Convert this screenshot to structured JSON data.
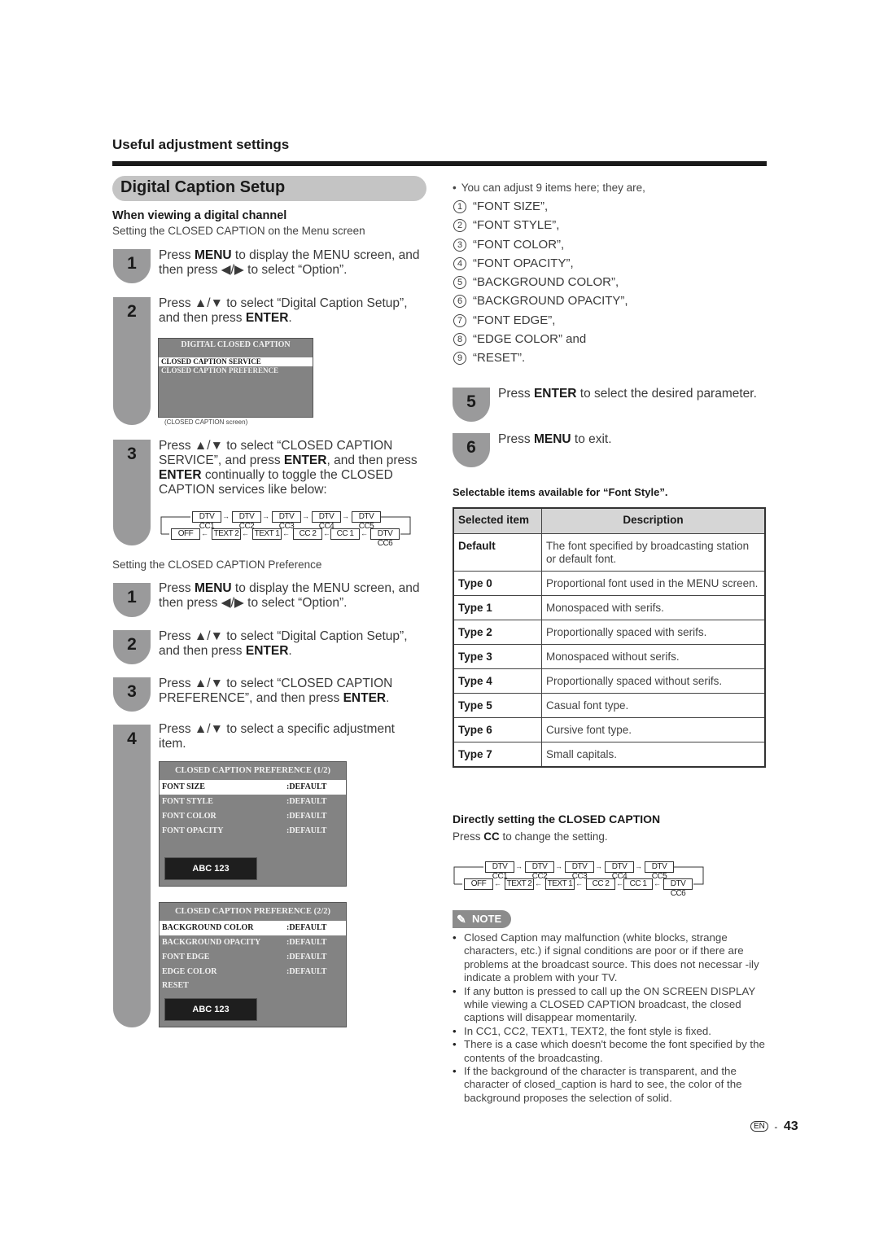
{
  "header": {
    "section_title": "Useful adjustment settings",
    "page_title": "Digital Caption Setup"
  },
  "left": {
    "subhead": "When viewing a digital channel",
    "subtext": "Setting the CLOSED CAPTION on the Menu screen",
    "service_steps": [
      {
        "num": "1",
        "pre": "Press ",
        "key": "MENU",
        "post": " to display the MENU screen, and then press ◀/▶ to select “Option”."
      },
      {
        "num": "2",
        "pre": "Press ▲/▼ to select “Digital Caption Setup”, and then press ",
        "key": "ENTER",
        "post": "."
      },
      {
        "num": "3",
        "pre": "Press ▲/▼ to select “CLOSED CAPTION SERVICE”, and press ",
        "key": "ENTER",
        "post": ", and then press",
        "key2": "ENTER",
        "post2": " continually to toggle the CLOSED CAPTION services like below:"
      }
    ],
    "osd_main": {
      "title": "DIGITAL CLOSED CAPTION",
      "items": [
        "CLOSED CAPTION SERVICE",
        "CLOSED CAPTION PREFERENCE"
      ],
      "selected_index": 0,
      "caption": "(CLOSED CAPTION  screen)"
    },
    "pref_subtext": "Setting the CLOSED CAPTION Preference",
    "pref_steps": [
      {
        "num": "1",
        "pre": "Press ",
        "key": "MENU",
        "post": " to display the MENU screen, and then press ◀/▶ to select “Option”."
      },
      {
        "num": "2",
        "pre": "Press ▲/▼ to select “Digital Caption Setup”, and then press ",
        "key": "ENTER",
        "post": "."
      },
      {
        "num": "3",
        "pre": "Press ▲/▼ to select “CLOSED CAPTION PREFERENCE”, and then press ",
        "key": "ENTER",
        "post": "."
      },
      {
        "num": "4",
        "pre": "Press ▲/▼ to select a specific adjustment item.",
        "key": "",
        "post": ""
      }
    ],
    "osd_pref1": {
      "title": "CLOSED CAPTION PREFERENCE (1/2)",
      "rows": [
        {
          "label": "FONT SIZE",
          "value": ":DEFAULT"
        },
        {
          "label": "FONT STYLE",
          "value": ":DEFAULT"
        },
        {
          "label": "FONT COLOR",
          "value": ":DEFAULT"
        },
        {
          "label": "FONT OPACITY",
          "value": ":DEFAULT"
        }
      ],
      "selected_index": 0,
      "sample": "ABC 123"
    },
    "osd_pref2": {
      "title": "CLOSED CAPTION PREFERENCE (2/2)",
      "rows": [
        {
          "label": "BACKGROUND COLOR",
          "value": ":DEFAULT"
        },
        {
          "label": "BACKGROUND OPACITY",
          "value": ":DEFAULT"
        },
        {
          "label": "FONT EDGE",
          "value": ":DEFAULT"
        },
        {
          "label": "EDGE COLOR",
          "value": ":DEFAULT"
        },
        {
          "label": "RESET",
          "value": ""
        }
      ],
      "selected_index": 0,
      "sample": "ABC 123"
    }
  },
  "cc_cycle": {
    "top": [
      "DTV CC1",
      "DTV CC2",
      "DTV CC3",
      "DTV CC4",
      "DTV CC5"
    ],
    "bottom": [
      "OFF",
      "TEXT 2",
      "TEXT 1",
      "CC 2",
      "CC 1",
      "DTV CC6"
    ]
  },
  "right": {
    "intro": "You can adjust 9 items here; they are,",
    "items": [
      {
        "n": "1",
        "text": "“FONT SIZE”,"
      },
      {
        "n": "2",
        "text": "“FONT STYLE”,"
      },
      {
        "n": "3",
        "text": "“FONT COLOR”,"
      },
      {
        "n": "4",
        "text": "“FONT OPACITY”,"
      },
      {
        "n": "5",
        "text": "“BACKGROUND COLOR”,"
      },
      {
        "n": "6",
        "text": "“BACKGROUND OPACITY”,"
      },
      {
        "n": "7",
        "text": "“FONT EDGE”,"
      },
      {
        "n": "8",
        "text": "“EDGE COLOR” and"
      },
      {
        "n": "9",
        "text": "“RESET”."
      }
    ],
    "steps": [
      {
        "num": "5",
        "pre": "Press ",
        "key": "ENTER",
        "post": " to select the desired parameter."
      },
      {
        "num": "6",
        "pre": "Press ",
        "key": "MENU",
        "post": " to exit."
      }
    ],
    "table_title": "Selectable items available for “Font Style”.",
    "table": {
      "headers": [
        "Selected item",
        "Description"
      ],
      "rows": [
        [
          "Default",
          "The font specified by broadcasting station or default font."
        ],
        [
          "Type 0",
          "Proportional font used in the MENU screen."
        ],
        [
          "Type 1",
          "Monospaced with serifs."
        ],
        [
          "Type 2",
          "Proportionally spaced with serifs."
        ],
        [
          "Type 3",
          "Monospaced without serifs."
        ],
        [
          "Type 4",
          "Proportionally spaced without serifs."
        ],
        [
          "Type 5",
          "Casual font type."
        ],
        [
          "Type 6",
          "Cursive font type."
        ],
        [
          "Type 7",
          "Small capitals."
        ]
      ]
    },
    "direct_title": "Directly setting the CLOSED CAPTION",
    "direct_pre": "Press ",
    "direct_key": "CC",
    "direct_post": " to change the setting.",
    "note_label": "NOTE",
    "notes": [
      "Closed Caption may malfunction (white blocks, strange characters, etc.) if signal conditions are poor or if there are problems at the broadcast source. This does not necessar -ily indicate a problem with your TV.",
      "If any button is pressed to call up the ON SCREEN DISPLAY while viewing a CLOSED CAPTION broadcast, the closed captions will disappear momentarily.",
      "In CC1, CC2, TEXT1, TEXT2, the font style is fixed.",
      "There is a case which doesn't become the font specified by the contents of the broadcasting.",
      "If the background of the character is transparent, and the character of closed_caption is hard to see, the color of the background proposes the selection of solid."
    ]
  },
  "footer": {
    "lang": "EN",
    "sep": "-",
    "page": "43"
  }
}
